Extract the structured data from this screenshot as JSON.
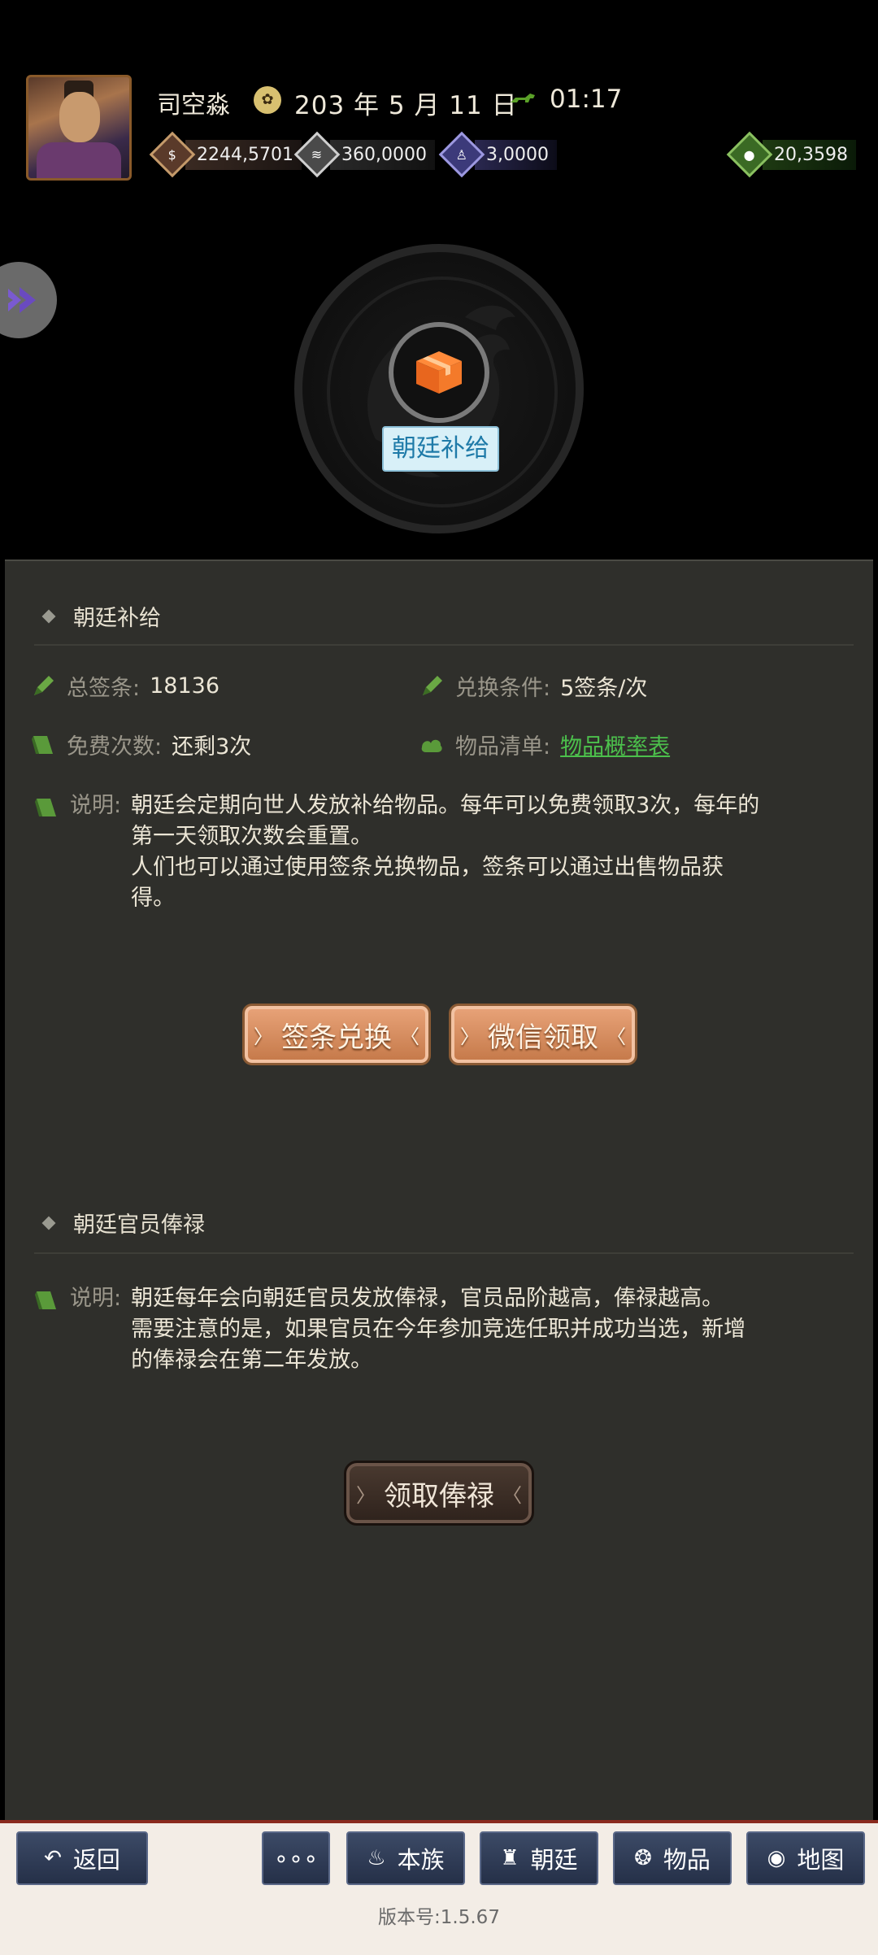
{
  "header": {
    "player_name": "司空淼",
    "date_icon": "calendar-seal-icon",
    "date": "203 年 5 月 11 日",
    "time": "01:17",
    "resources": [
      {
        "icon": "coin-icon",
        "value": "2244,5701"
      },
      {
        "icon": "grain-icon",
        "value": "360,0000"
      },
      {
        "icon": "soldier-icon",
        "value": "3,0000"
      },
      {
        "icon": "money-bag-icon",
        "value": "20,3598"
      }
    ]
  },
  "supply": {
    "badge_label": "朝廷补给",
    "section_title": "朝廷补给",
    "total_label": "总签条:",
    "total_value": "18136",
    "exchange_label": "兑换条件:",
    "exchange_value": "5签条/次",
    "free_label": "免费次数:",
    "free_value": "还剩3次",
    "list_label": "物品清单:",
    "list_link": "物品概率表",
    "desc_label": "说明:",
    "desc_text": "朝廷会定期向世人发放补给物品。每年可以免费领取3次，每年的\n第一天领取次数会重置。\n人们也可以通过使用签条兑换物品，签条可以通过出售物品获\n得。",
    "btn_exchange": "签条兑换",
    "btn_wechat": "微信领取"
  },
  "salary": {
    "section_title": "朝廷官员俸禄",
    "desc_label": "说明:",
    "desc_text": "朝廷每年会向朝廷官员发放俸禄，官员品阶越高，俸禄越高。\n需要注意的是，如果官员在今年参加竞选任职并成功当选，新增\n的俸禄会在第二年发放。",
    "btn_claim": "领取俸禄"
  },
  "nav": {
    "back": "返回",
    "more": "∘∘∘",
    "clan": "本族",
    "court": "朝廷",
    "items": "物品",
    "map": "地图"
  },
  "version": "版本号:1.5.67",
  "colors": {
    "accent_link": "#4cc04c",
    "button_orange": "#d98c5c",
    "nav_blue": "#2e3a56"
  }
}
